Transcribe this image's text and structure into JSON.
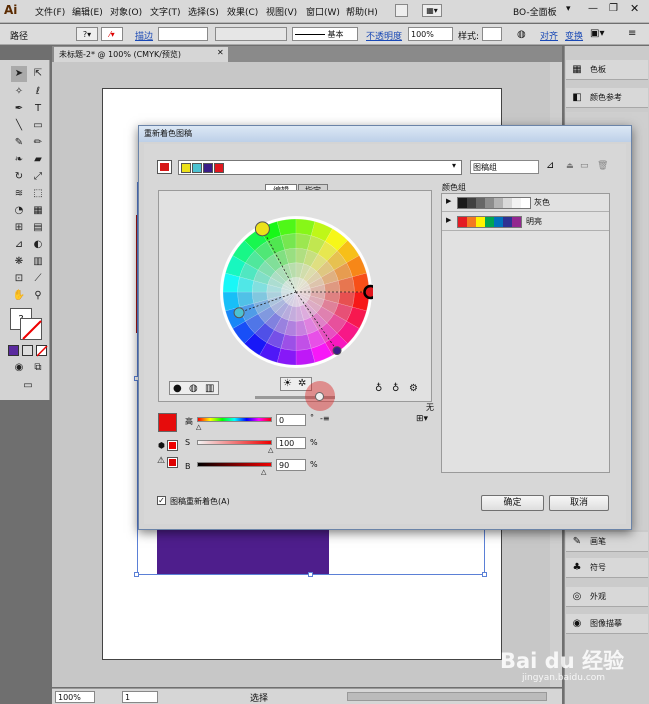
{
  "app": {
    "logo": "Ai",
    "menu": [
      "文件(F)",
      "编辑(E)",
      "对象(O)",
      "文字(T)",
      "选择(S)",
      "效果(C)",
      "视图(V)",
      "窗口(W)",
      "帮助(H)"
    ],
    "workspace": "BO-全面板"
  },
  "control": {
    "path_label": "路径",
    "stroke_label": "描边",
    "stroke_style": "基本",
    "opacity_label": "不透明度",
    "opacity_value": "100%",
    "style_label": "样式:",
    "align_label": "对齐",
    "transform_label": "变换"
  },
  "document": {
    "tab_title": "未标题-2* @ 100% (CMYK/预览)",
    "zoom": "100%",
    "page": "1",
    "status": "选择"
  },
  "panels": [
    "色板",
    "颜色参考",
    "画笔",
    "符号",
    "外观",
    "图像描摹"
  ],
  "dialog": {
    "title": "重新着色图稿",
    "group_name": "图稿组",
    "tabs": [
      "编辑",
      "指定"
    ],
    "label_hue": "高",
    "hue_value": "0",
    "hue_unit": "°",
    "label_s": "S",
    "s_value": "100",
    "label_b": "B",
    "b_value": "90",
    "percent": "%",
    "none_label": "无",
    "color_groups_label": "颜色组",
    "groups": [
      {
        "name": "灰色",
        "colors": [
          "#1a1a1a",
          "#404040",
          "#666666",
          "#8c8c8c",
          "#b3b3b3",
          "#d9d9d9",
          "#f2f2f2",
          "#ffffff"
        ]
      },
      {
        "name": "明亮",
        "colors": [
          "#e31b23",
          "#f47920",
          "#fff200",
          "#00a651",
          "#0072bc",
          "#2e3192",
          "#92278f"
        ]
      }
    ],
    "current_colors": [
      "#ece11a",
      "#4cc2d2",
      "#3a1c87",
      "#e0171e"
    ],
    "recolor_checkbox": "图稿重新着色(A)",
    "ok": "确定",
    "cancel": "取消"
  },
  "watermark": {
    "brand": "Bai du 经验",
    "url": "jingyan.baidu.com"
  }
}
